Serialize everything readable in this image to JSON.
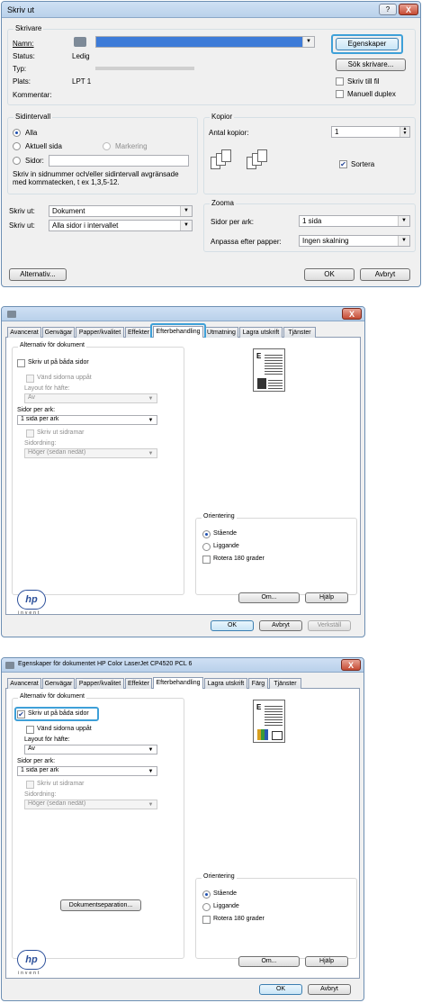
{
  "print_dialog": {
    "title": "Skriv ut",
    "help_label": "?",
    "close_label": "X",
    "printer_group": "Skrivare",
    "name_label": "Namn:",
    "status_label": "Status:",
    "status_value": "Ledig",
    "type_label": "Typ:",
    "location_label": "Plats:",
    "location_value": "LPT 1",
    "comment_label": "Kommentar:",
    "properties_button": "Egenskaper",
    "find_printer_button": "Sök skrivare...",
    "print_to_file_label": "Skriv till fil",
    "manual_duplex_label": "Manuell duplex",
    "page_range_group": "Sidintervall",
    "all_label": "Alla",
    "current_page_label": "Aktuell sida",
    "selection_label": "Markering",
    "pages_label": "Sidor:",
    "pages_help": "Skriv in sidnummer och/eller sidintervall avgränsade med kommatecken, t ex 1,3,5-12.",
    "copies_group": "Kopior",
    "copies_label": "Antal kopior:",
    "copies_value": "1",
    "collate_label": "Sortera",
    "print_what_label": "Skriv ut:",
    "print_what_value": "Dokument",
    "print_label": "Skriv ut:",
    "print_value": "Alla sidor i intervallet",
    "zoom_group": "Zooma",
    "pages_per_sheet_label": "Sidor per ark:",
    "pages_per_sheet_value": "1 sida",
    "scale_label": "Anpassa efter papper:",
    "scale_value": "Ingen skalning",
    "options_button": "Alternativ...",
    "ok_button": "OK",
    "cancel_button": "Avbryt"
  },
  "props_dialog_1": {
    "tabs": [
      "Avancerat",
      "Genvägar",
      "Papper/kvalitet",
      "Effekter",
      "Efterbehandling",
      "Utmatning",
      "Lagra utskrift",
      "Tjänster"
    ],
    "doc_options_group": "Alternativ för dokument",
    "duplex_label": "Skriv ut på båda sidor",
    "flip_up_label": "Vänd sidorna uppåt",
    "booklet_label": "Layout för häfte:",
    "booklet_value": "Av",
    "pps_label": "Sidor per ark:",
    "pps_value": "1 sida per ark",
    "borders_label": "Skriv ut sidramar",
    "page_order_label": "Sidordning:",
    "page_order_value": "Höger (sedan nedåt)",
    "orientation_group": "Orientering",
    "portrait_label": "Stående",
    "landscape_label": "Liggande",
    "rotate_label": "Rotera 180 grader",
    "about_button": "Om...",
    "help_button": "Hjälp",
    "ok_button": "OK",
    "cancel_button": "Avbryt",
    "apply_button": "Verkställ",
    "logo_text": "hp",
    "invent_text": "invent"
  },
  "props_dialog_2": {
    "title": "Egenskaper för dokumentet HP Color LaserJet CP4520 PCL 6",
    "tabs": [
      "Avancerat",
      "Genvägar",
      "Papper/kvalitet",
      "Effekter",
      "Efterbehandling",
      "Lagra utskrift",
      "Färg",
      "Tjänster"
    ],
    "doc_options_group": "Alternativ för dokument",
    "duplex_label": "Skriv ut på båda sidor",
    "flip_up_label": "Vänd sidorna uppåt",
    "booklet_label": "Layout för häfte:",
    "booklet_value": "Av",
    "pps_label": "Sidor per ark:",
    "pps_value": "1 sida per ark",
    "borders_label": "Skriv ut sidramar",
    "page_order_label": "Sidordning:",
    "page_order_value": "Höger (sedan nedåt)",
    "separation_button": "Dokumentseparation...",
    "orientation_group": "Orientering",
    "portrait_label": "Stående",
    "landscape_label": "Liggande",
    "rotate_label": "Rotera 180 grader",
    "about_button": "Om...",
    "help_button": "Hjälp",
    "ok_button": "OK",
    "cancel_button": "Avbryt",
    "logo_text": "hp",
    "invent_text": "invent"
  },
  "colors": {
    "highlight": "#3ea0d8",
    "titlebar": "#c4d8ee",
    "close": "#c54b34"
  },
  "icons": [
    "printer-icon",
    "close-icon",
    "help-icon",
    "hp-logo"
  ]
}
